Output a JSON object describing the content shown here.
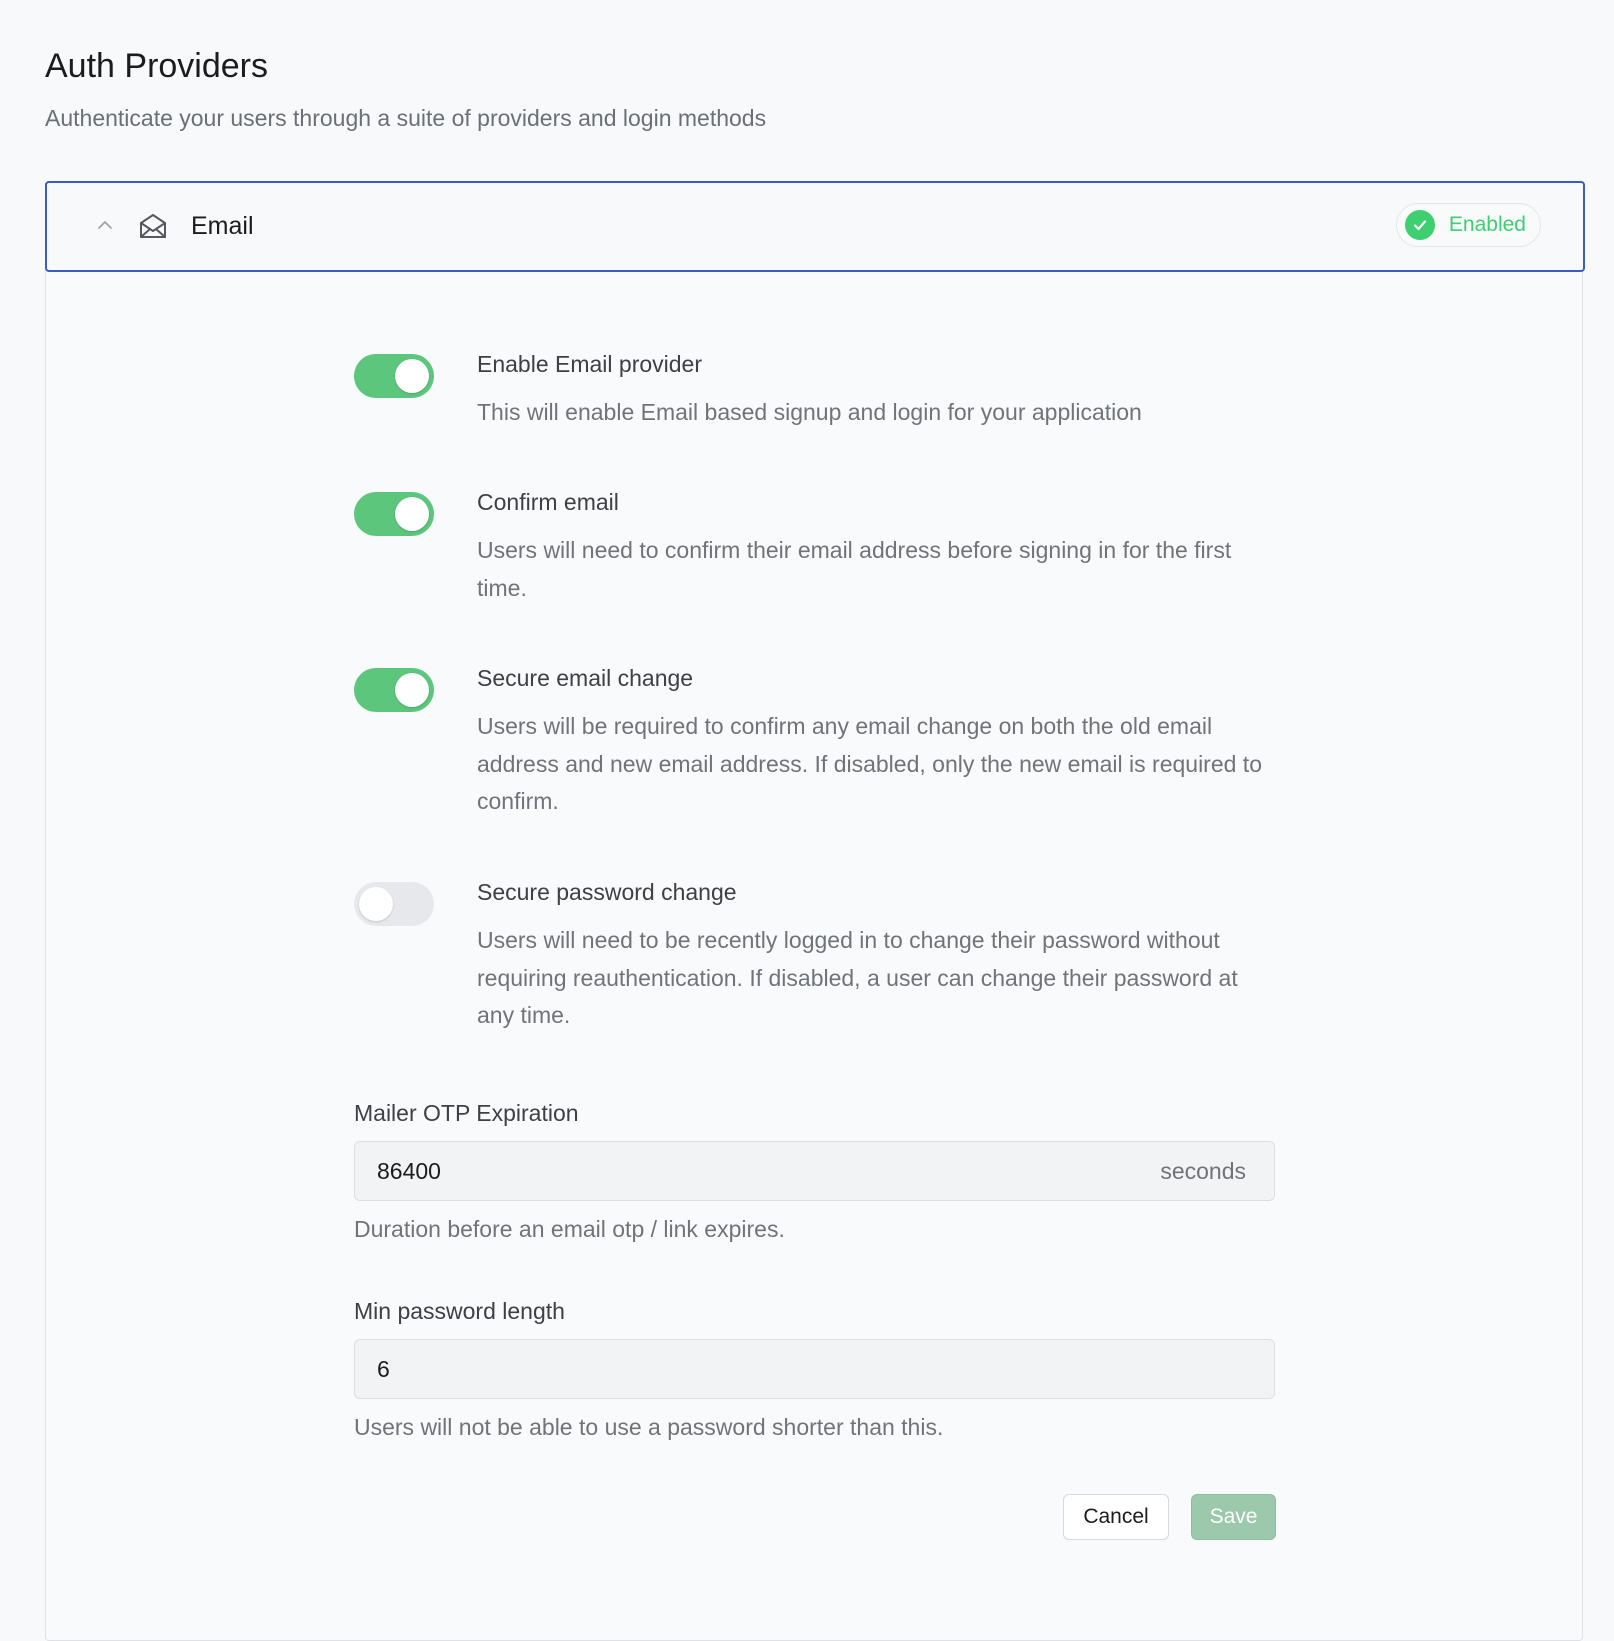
{
  "page": {
    "title": "Auth Providers",
    "subtitle": "Authenticate your users through a suite of providers and login methods"
  },
  "provider": {
    "name": "Email",
    "status": "Enabled",
    "icons": {
      "collapse": "chevron-up-icon",
      "provider": "mail-open-icon",
      "status": "check-circle-icon"
    },
    "colors": {
      "accent": "#3ecf71",
      "toggle_on": "#5cc67d",
      "header_border": "#3b5cc4"
    }
  },
  "settings": [
    {
      "title": "Enable Email provider",
      "description": "This will enable Email based signup and login for your application",
      "enabled": true
    },
    {
      "title": "Confirm email",
      "description": "Users will need to confirm their email address before signing in for the first time.",
      "enabled": true
    },
    {
      "title": "Secure email change",
      "description": "Users will be required to confirm any email change on both the old email address and new email address. If disabled, only the new email is required to confirm.",
      "enabled": true
    },
    {
      "title": "Secure password change",
      "description": "Users will need to be recently logged in to change their password without requiring reauthentication. If disabled, a user can change their password at any time.",
      "enabled": false
    }
  ],
  "fields": {
    "otp_expiration": {
      "label": "Mailer OTP Expiration",
      "value": "86400",
      "suffix": "seconds",
      "help": "Duration before an email otp / link expires."
    },
    "min_password_length": {
      "label": "Min password length",
      "value": "6",
      "help": "Users will not be able to use a password shorter than this."
    }
  },
  "actions": {
    "cancel_label": "Cancel",
    "save_label": "Save"
  }
}
